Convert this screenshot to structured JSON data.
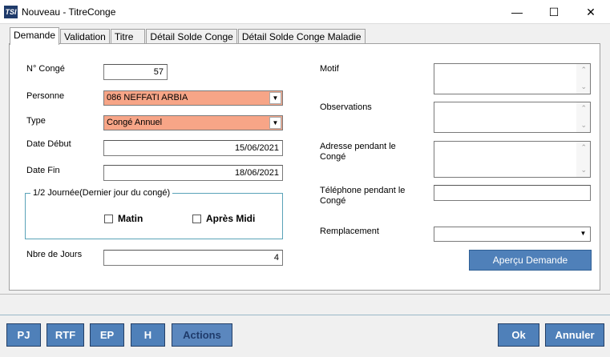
{
  "window": {
    "title": "Nouveau - TitreConge",
    "icon_text": "TSI",
    "minimize_glyph": "—",
    "maximize_glyph": "☐",
    "close_glyph": "✕"
  },
  "tabs": [
    {
      "label": "Demande",
      "active": true
    },
    {
      "label": "Validation"
    },
    {
      "label": "Titre"
    },
    {
      "label": "Détail Solde Conge"
    },
    {
      "label": "Détail Solde Conge Maladie"
    }
  ],
  "form": {
    "no_conge": {
      "label": "N° Congé",
      "value": "57"
    },
    "personne": {
      "label": "Personne",
      "value": "086 NEFFATI ARBIA"
    },
    "type": {
      "label": "Type",
      "value": "Congé Annuel"
    },
    "date_debut": {
      "label": "Date Début",
      "value": "15/06/2021"
    },
    "date_fin": {
      "label": "Date Fin",
      "value": "18/06/2021"
    },
    "demi_journee": {
      "legend": "1/2 Journée(Dernier jour du congé)",
      "matin": "Matin",
      "apres_midi": "Après Midi"
    },
    "nbre_jours": {
      "label": "Nbre de Jours",
      "value": "4"
    },
    "motif": {
      "label": "Motif",
      "value": ""
    },
    "observations": {
      "label": "Observations",
      "value": ""
    },
    "adresse": {
      "label_line1": "Adresse pendant le",
      "label_line2": "Congé",
      "value": ""
    },
    "telephone": {
      "label_line1": "Téléphone pendant le",
      "label_line2": "Congé",
      "value": ""
    },
    "remplacement": {
      "label": "Remplacement",
      "value": ""
    },
    "apercu_button": "Aperçu Demande"
  },
  "footer": {
    "pj": "PJ",
    "rtf": "RTF",
    "ep": "EP",
    "h": "H",
    "actions": "Actions",
    "ok": "Ok",
    "annuler": "Annuler"
  },
  "colors": {
    "highlight_field": "#f7a587",
    "button_blue": "#4f80b9"
  }
}
